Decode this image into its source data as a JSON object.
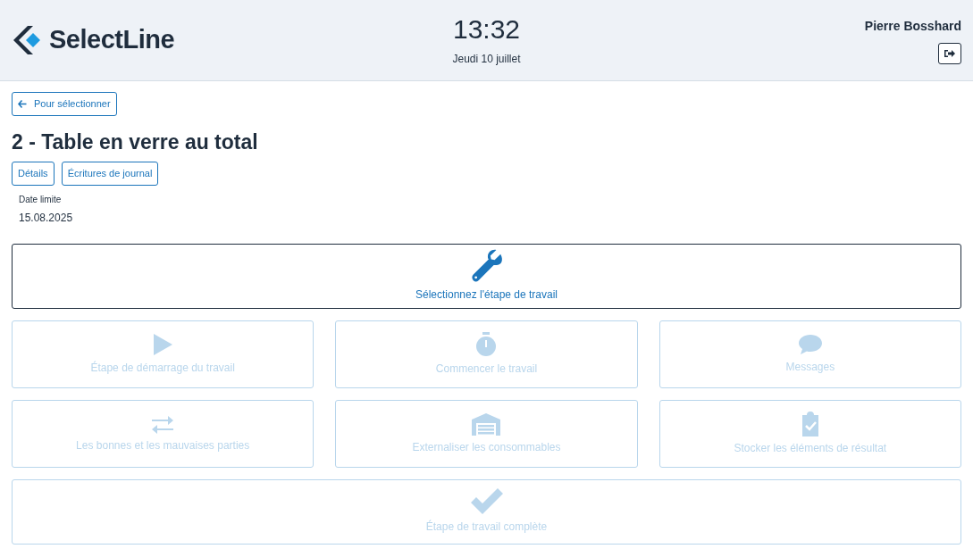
{
  "header": {
    "logo": "SelectLine",
    "time": "13:32",
    "date": "Jeudi 10 juillet",
    "user": "Pierre Bosshard"
  },
  "back_button": "Pour sélectionner",
  "title": "2 - Table en verre au total",
  "tabs": [
    {
      "label": "Détails"
    },
    {
      "label": "Écritures de journal"
    }
  ],
  "deadline": {
    "label": "Date limite",
    "value": "15.08.2025"
  },
  "actions": [
    {
      "label": "Sélectionnez l'étape de travail",
      "kind": "wrench",
      "disabled": false,
      "wide": true
    },
    {
      "label": "Étape de démarrage du travail",
      "kind": "play",
      "disabled": true,
      "wide": false
    },
    {
      "label": "Commencer le travail",
      "kind": "stopwatch",
      "disabled": true,
      "wide": false
    },
    {
      "label": "Messages",
      "kind": "chat",
      "disabled": true,
      "wide": false
    },
    {
      "label": "Les bonnes et les mauvaises parties",
      "kind": "swap",
      "disabled": true,
      "wide": false
    },
    {
      "label": "Externaliser les consommables",
      "kind": "warehouse",
      "disabled": true,
      "wide": false
    },
    {
      "label": "Stocker les éléments de résultat",
      "kind": "clipboard",
      "disabled": true,
      "wide": false
    },
    {
      "label": "Étape de travail complète",
      "kind": "check",
      "disabled": true,
      "wide": true
    }
  ]
}
